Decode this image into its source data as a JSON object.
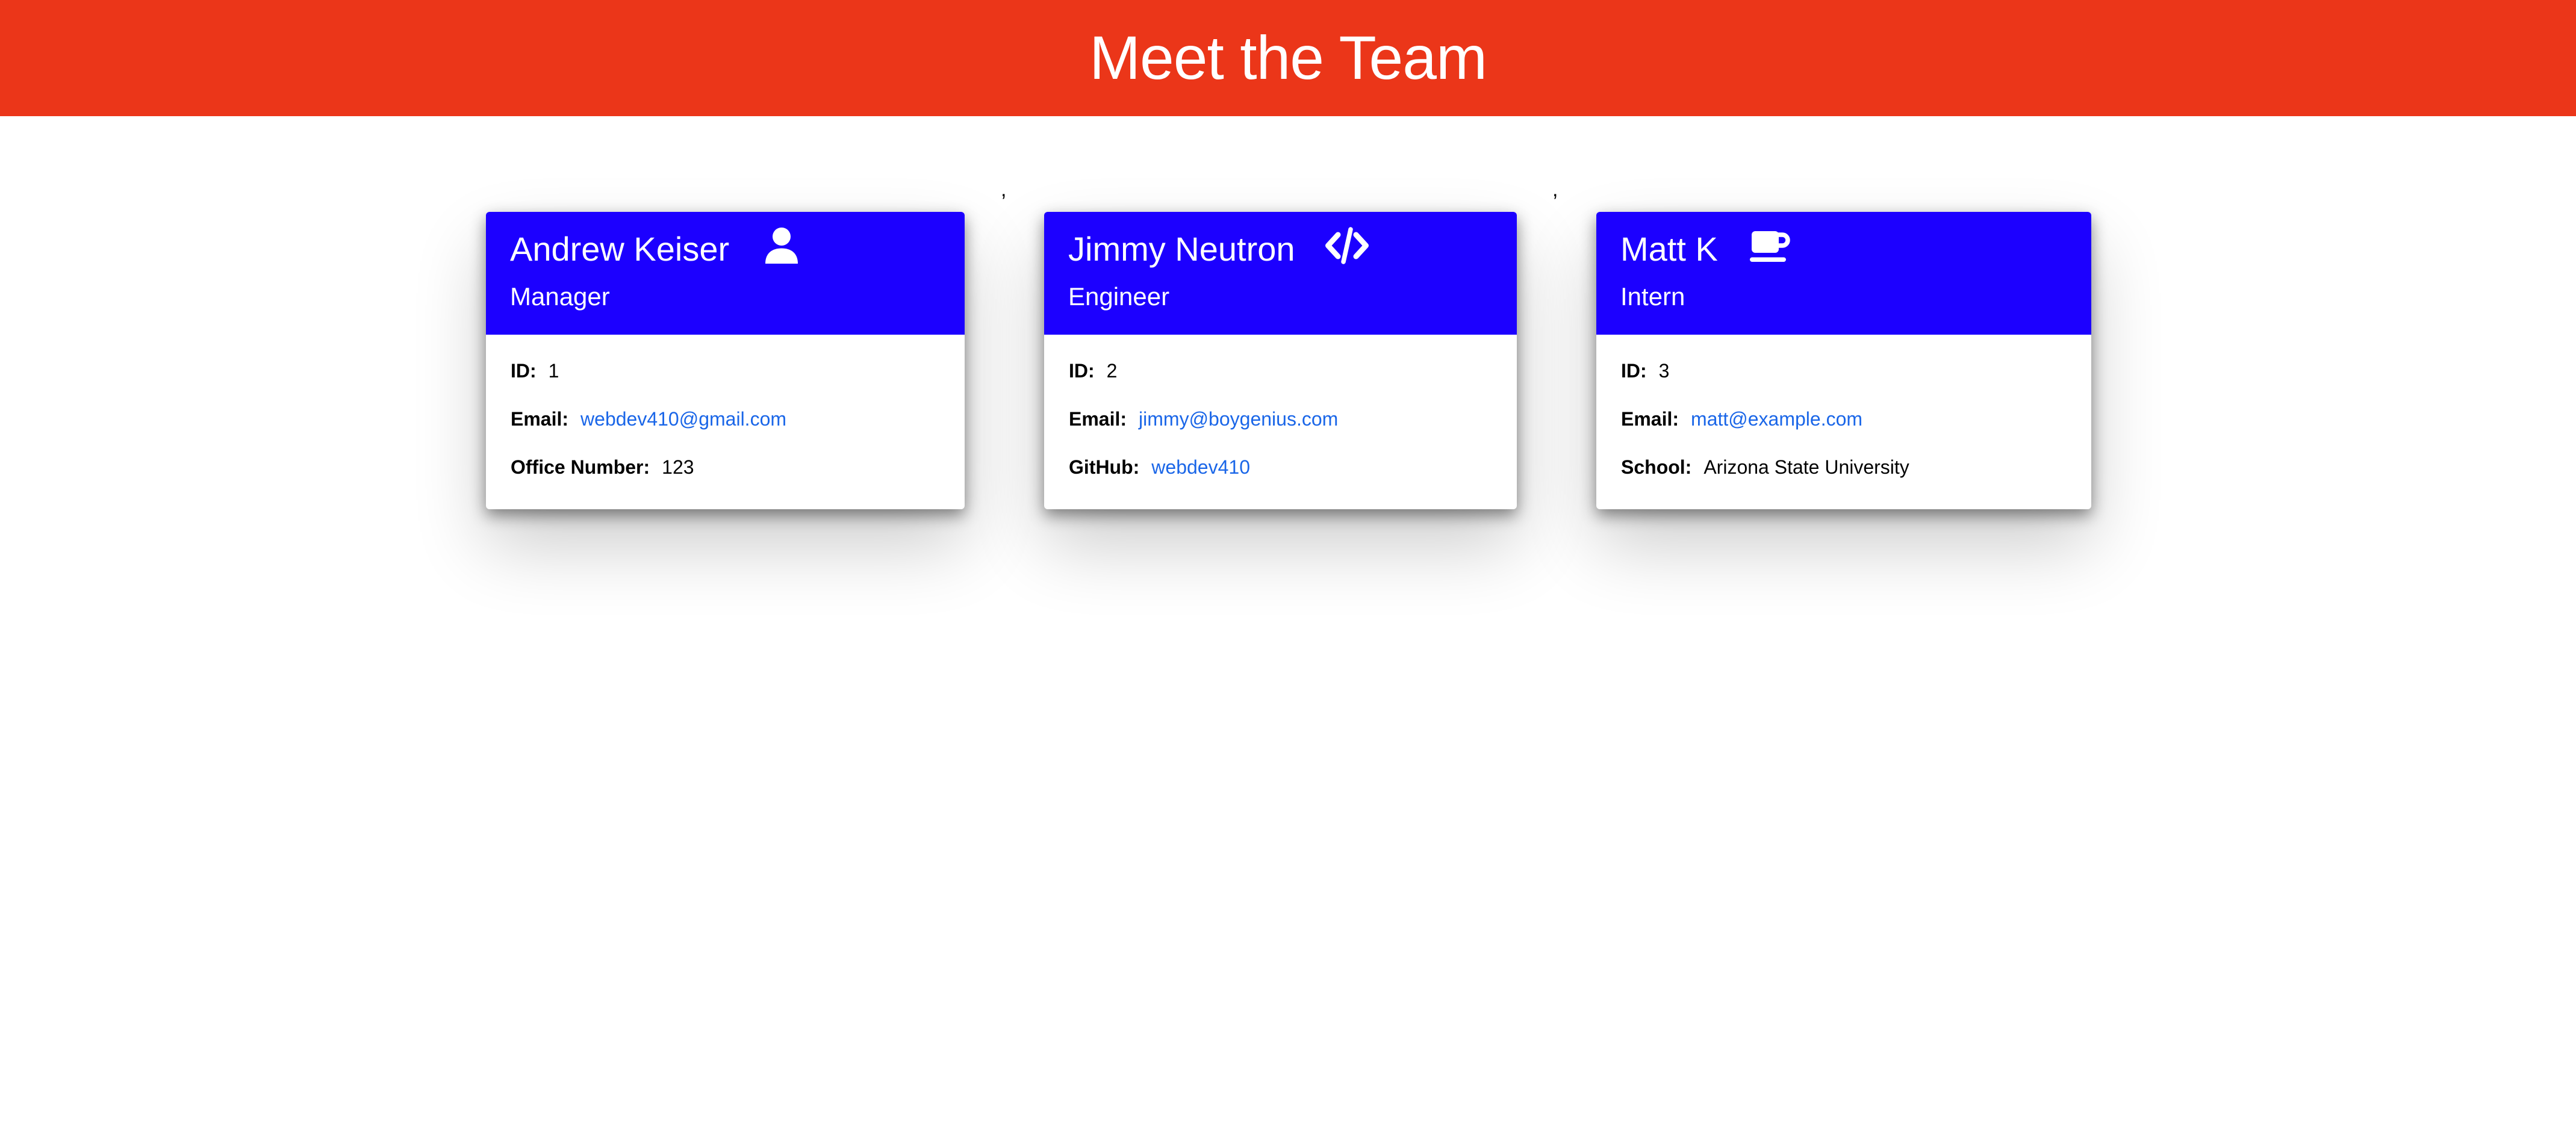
{
  "header": {
    "title": "Meet the Team"
  },
  "separators": [
    ",",
    ","
  ],
  "cards": [
    {
      "name": "Andrew Keiser",
      "icon": "user-icon",
      "role": "Manager",
      "rows": [
        {
          "label": "ID:",
          "value": "1"
        },
        {
          "label": "Email:",
          "value": "webdev410@gmail.com"
        },
        {
          "label": "Office Number:",
          "value": "123"
        }
      ]
    },
    {
      "name": "Jimmy Neutron",
      "icon": "code-icon",
      "role": "Engineer",
      "rows": [
        {
          "label": "ID:",
          "value": "2"
        },
        {
          "label": "Email:",
          "value": "jimmy@boygenius.com"
        },
        {
          "label": "GitHub:",
          "value": "webdev410"
        }
      ]
    },
    {
      "name": "Matt K",
      "icon": "coffee-icon",
      "role": "Intern",
      "rows": [
        {
          "label": "ID:",
          "value": "3"
        },
        {
          "label": "Email:",
          "value": "matt@example.com"
        },
        {
          "label": "School:",
          "value": "Arizona State University"
        }
      ]
    }
  ],
  "colors": {
    "header_bg": "#eb3619",
    "card_header_bg": "#1c00ff",
    "link": "#1a66e8"
  }
}
